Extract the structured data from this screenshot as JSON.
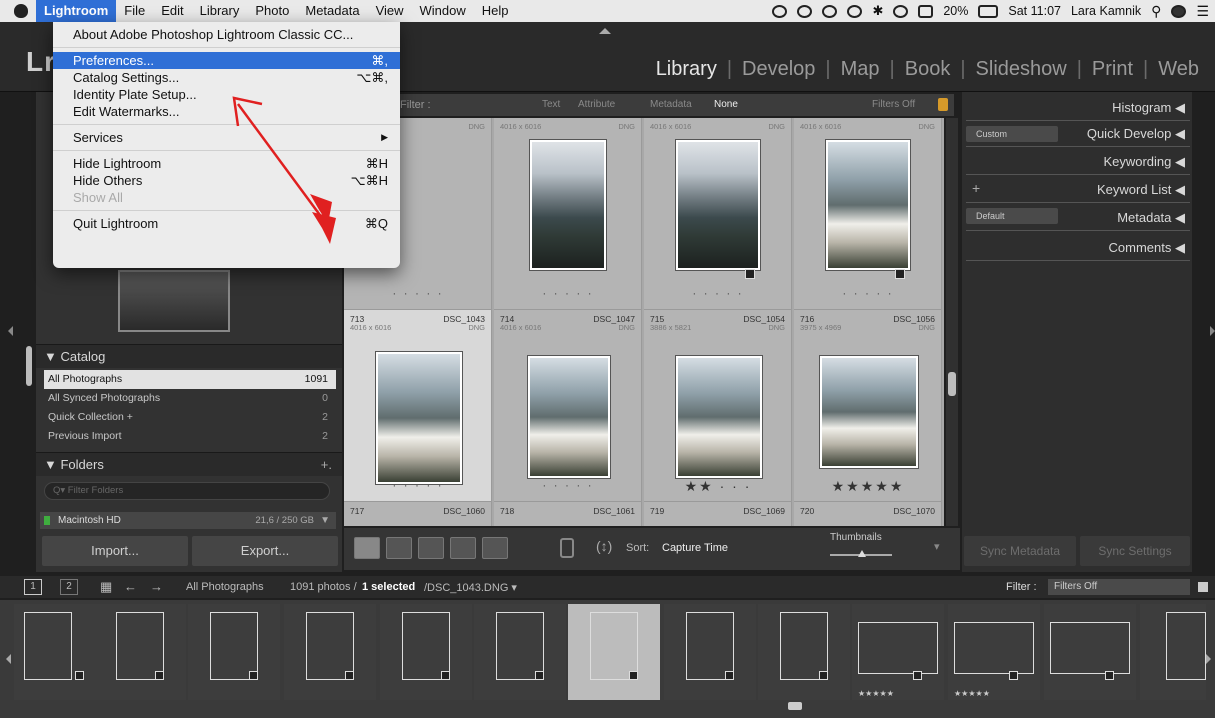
{
  "menubar": {
    "items": [
      "Lightroom",
      "File",
      "Edit",
      "Library",
      "Photo",
      "Metadata",
      "View",
      "Window",
      "Help"
    ],
    "battery": "20%",
    "time": "Sat 11:07",
    "user": "Lara Kamnik"
  },
  "app_menu": {
    "items": [
      {
        "label": "About Adobe Photoshop Lightroom Classic CC...",
        "shortcut": ""
      },
      {
        "label": "Preferences...",
        "shortcut": "⌘,"
      },
      {
        "label": "Catalog Settings...",
        "shortcut": "⌥⌘,"
      },
      {
        "label": "Identity Plate Setup...",
        "shortcut": ""
      },
      {
        "label": "Edit Watermarks...",
        "shortcut": ""
      },
      {
        "label": "Services",
        "shortcut": "▶"
      },
      {
        "label": "Hide Lightroom",
        "shortcut": "⌘H"
      },
      {
        "label": "Hide Others",
        "shortcut": "⌥⌘H"
      },
      {
        "label": "Show All",
        "shortcut": ""
      },
      {
        "label": "Quit Lightroom",
        "shortcut": "⌘Q"
      }
    ]
  },
  "logo": "Lr",
  "modules": [
    "Library",
    "Develop",
    "Map",
    "Book",
    "Slideshow",
    "Print",
    "Web"
  ],
  "filter_bar": {
    "label": "Filter :",
    "tabs": [
      "Text",
      "Attribute",
      "Metadata",
      "None"
    ],
    "status": "Filters Off"
  },
  "grid": {
    "top_row": [
      {
        "dim": "",
        "ext": "DNG"
      },
      {
        "dim": "4016 x 6016",
        "ext": "DNG"
      },
      {
        "dim": "4016 x 6016",
        "ext": "DNG"
      },
      {
        "dim": "4016 x 6016",
        "ext": "DNG"
      }
    ],
    "mid_row": [
      {
        "num": "713",
        "name": "DSC_1043",
        "dim": "4016 x 6016",
        "ext": "DNG",
        "rating": "· · · · ·"
      },
      {
        "num": "714",
        "name": "DSC_1047",
        "dim": "4016 x 6016",
        "ext": "DNG",
        "rating": "· · · · ·"
      },
      {
        "num": "715",
        "name": "DSC_1054",
        "dim": "3886 x 5821",
        "ext": "DNG",
        "rating": "★★ · · ·"
      },
      {
        "num": "716",
        "name": "DSC_1056",
        "dim": "3975 x 4969",
        "ext": "DNG",
        "rating": "★★★★★"
      }
    ],
    "bottom_row": [
      {
        "num": "717",
        "name": "DSC_1060"
      },
      {
        "num": "718",
        "name": "DSC_1061"
      },
      {
        "num": "719",
        "name": "DSC_1069"
      },
      {
        "num": "720",
        "name": "DSC_1070"
      }
    ],
    "top_rating": "· · · · ·"
  },
  "catalog": {
    "title": "Catalog",
    "rows": [
      {
        "label": "All Photographs",
        "count": "1091"
      },
      {
        "label": "All Synced Photographs",
        "count": "0"
      },
      {
        "label": "Quick Collection +",
        "count": "2"
      },
      {
        "label": "Previous Import",
        "count": "2"
      }
    ]
  },
  "folders": {
    "title": "Folders",
    "add": "+.",
    "filter_placeholder": "Q▾ Filter Folders",
    "volume_name": "Macintosh HD",
    "volume_size": "21,6 / 250 GB"
  },
  "buttons": {
    "import": "Import...",
    "export": "Export..."
  },
  "toolbar": {
    "sort_label": "Sort:",
    "sort_value": "Capture Time",
    "thumbnails_label": "Thumbnails"
  },
  "right_panel": {
    "histogram": "Histogram",
    "quick_develop": "Quick Develop",
    "quick_develop_preset": "Custom",
    "keywording": "Keywording",
    "keyword_list": "Keyword List",
    "metadata": "Metadata",
    "metadata_preset": "Default",
    "comments": "Comments",
    "sync_metadata": "Sync Metadata",
    "sync_settings": "Sync Settings"
  },
  "filmstrip_bar": {
    "page1": "1",
    "page2": "2",
    "source": "All Photographs",
    "count_prefix": "1091 photos /",
    "selected": "1 selected",
    "file": "/DSC_1043.DNG ▾",
    "filter_label": "Filter :",
    "filter_value": "Filters Off"
  },
  "colors": {
    "menu_highlight": "#2f6fd6",
    "arrow": "#e02020",
    "stars_fs": "★★★★★"
  }
}
